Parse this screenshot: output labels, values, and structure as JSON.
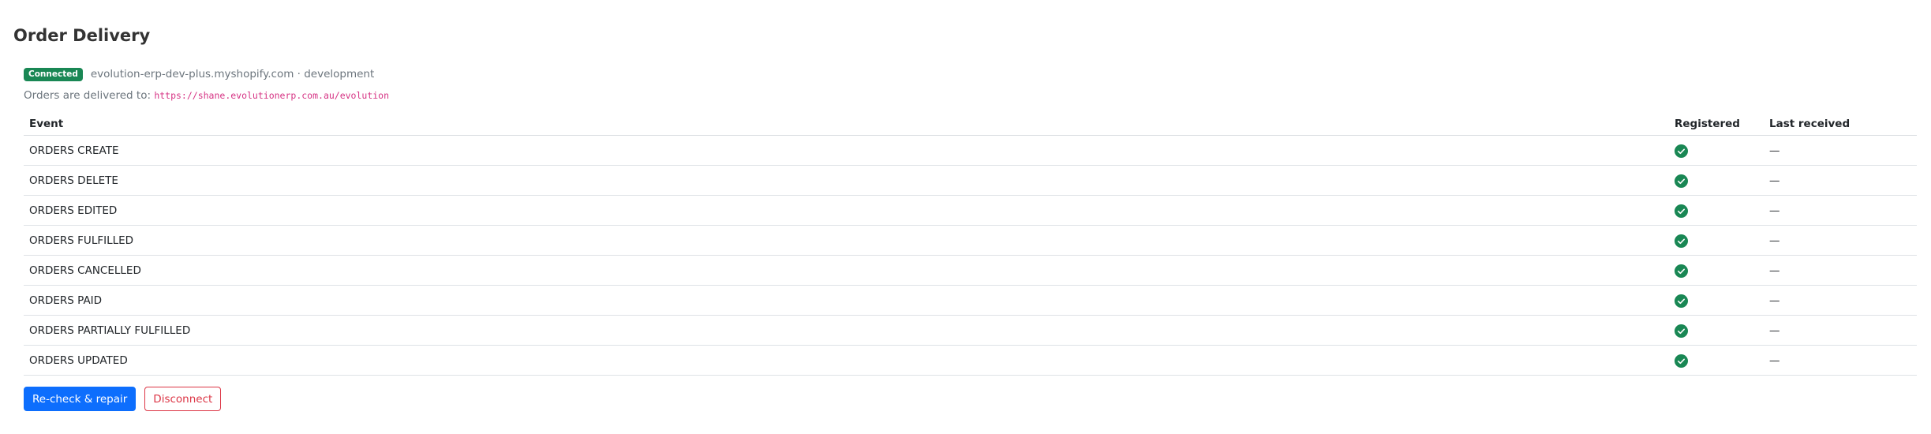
{
  "page": {
    "title": "Order Delivery"
  },
  "connection": {
    "status_badge": "Connected",
    "store": "evolution-erp-dev-plus.myshopify.com · development",
    "delivery_prefix": "Orders are delivered to:",
    "delivery_url": "https://shane.evolutionerp.com.au/evolution"
  },
  "table": {
    "headers": {
      "event": "Event",
      "registered": "Registered",
      "last_received": "Last received"
    },
    "rows": [
      {
        "event": "ORDERS CREATE",
        "registered": true,
        "last_received": "—"
      },
      {
        "event": "ORDERS DELETE",
        "registered": true,
        "last_received": "—"
      },
      {
        "event": "ORDERS EDITED",
        "registered": true,
        "last_received": "—"
      },
      {
        "event": "ORDERS FULFILLED",
        "registered": true,
        "last_received": "—"
      },
      {
        "event": "ORDERS CANCELLED",
        "registered": true,
        "last_received": "—"
      },
      {
        "event": "ORDERS PAID",
        "registered": true,
        "last_received": "—"
      },
      {
        "event": "ORDERS PARTIALLY FULFILLED",
        "registered": true,
        "last_received": "—"
      },
      {
        "event": "ORDERS UPDATED",
        "registered": true,
        "last_received": "—"
      }
    ]
  },
  "actions": {
    "recheck_label": "Re-check & repair",
    "disconnect_label": "Disconnect"
  },
  "colors": {
    "success": "#198754",
    "primary": "#0d6efd",
    "danger": "#dc3545",
    "code": "#d63384"
  },
  "icons": {
    "registered": "check-circle-icon"
  }
}
